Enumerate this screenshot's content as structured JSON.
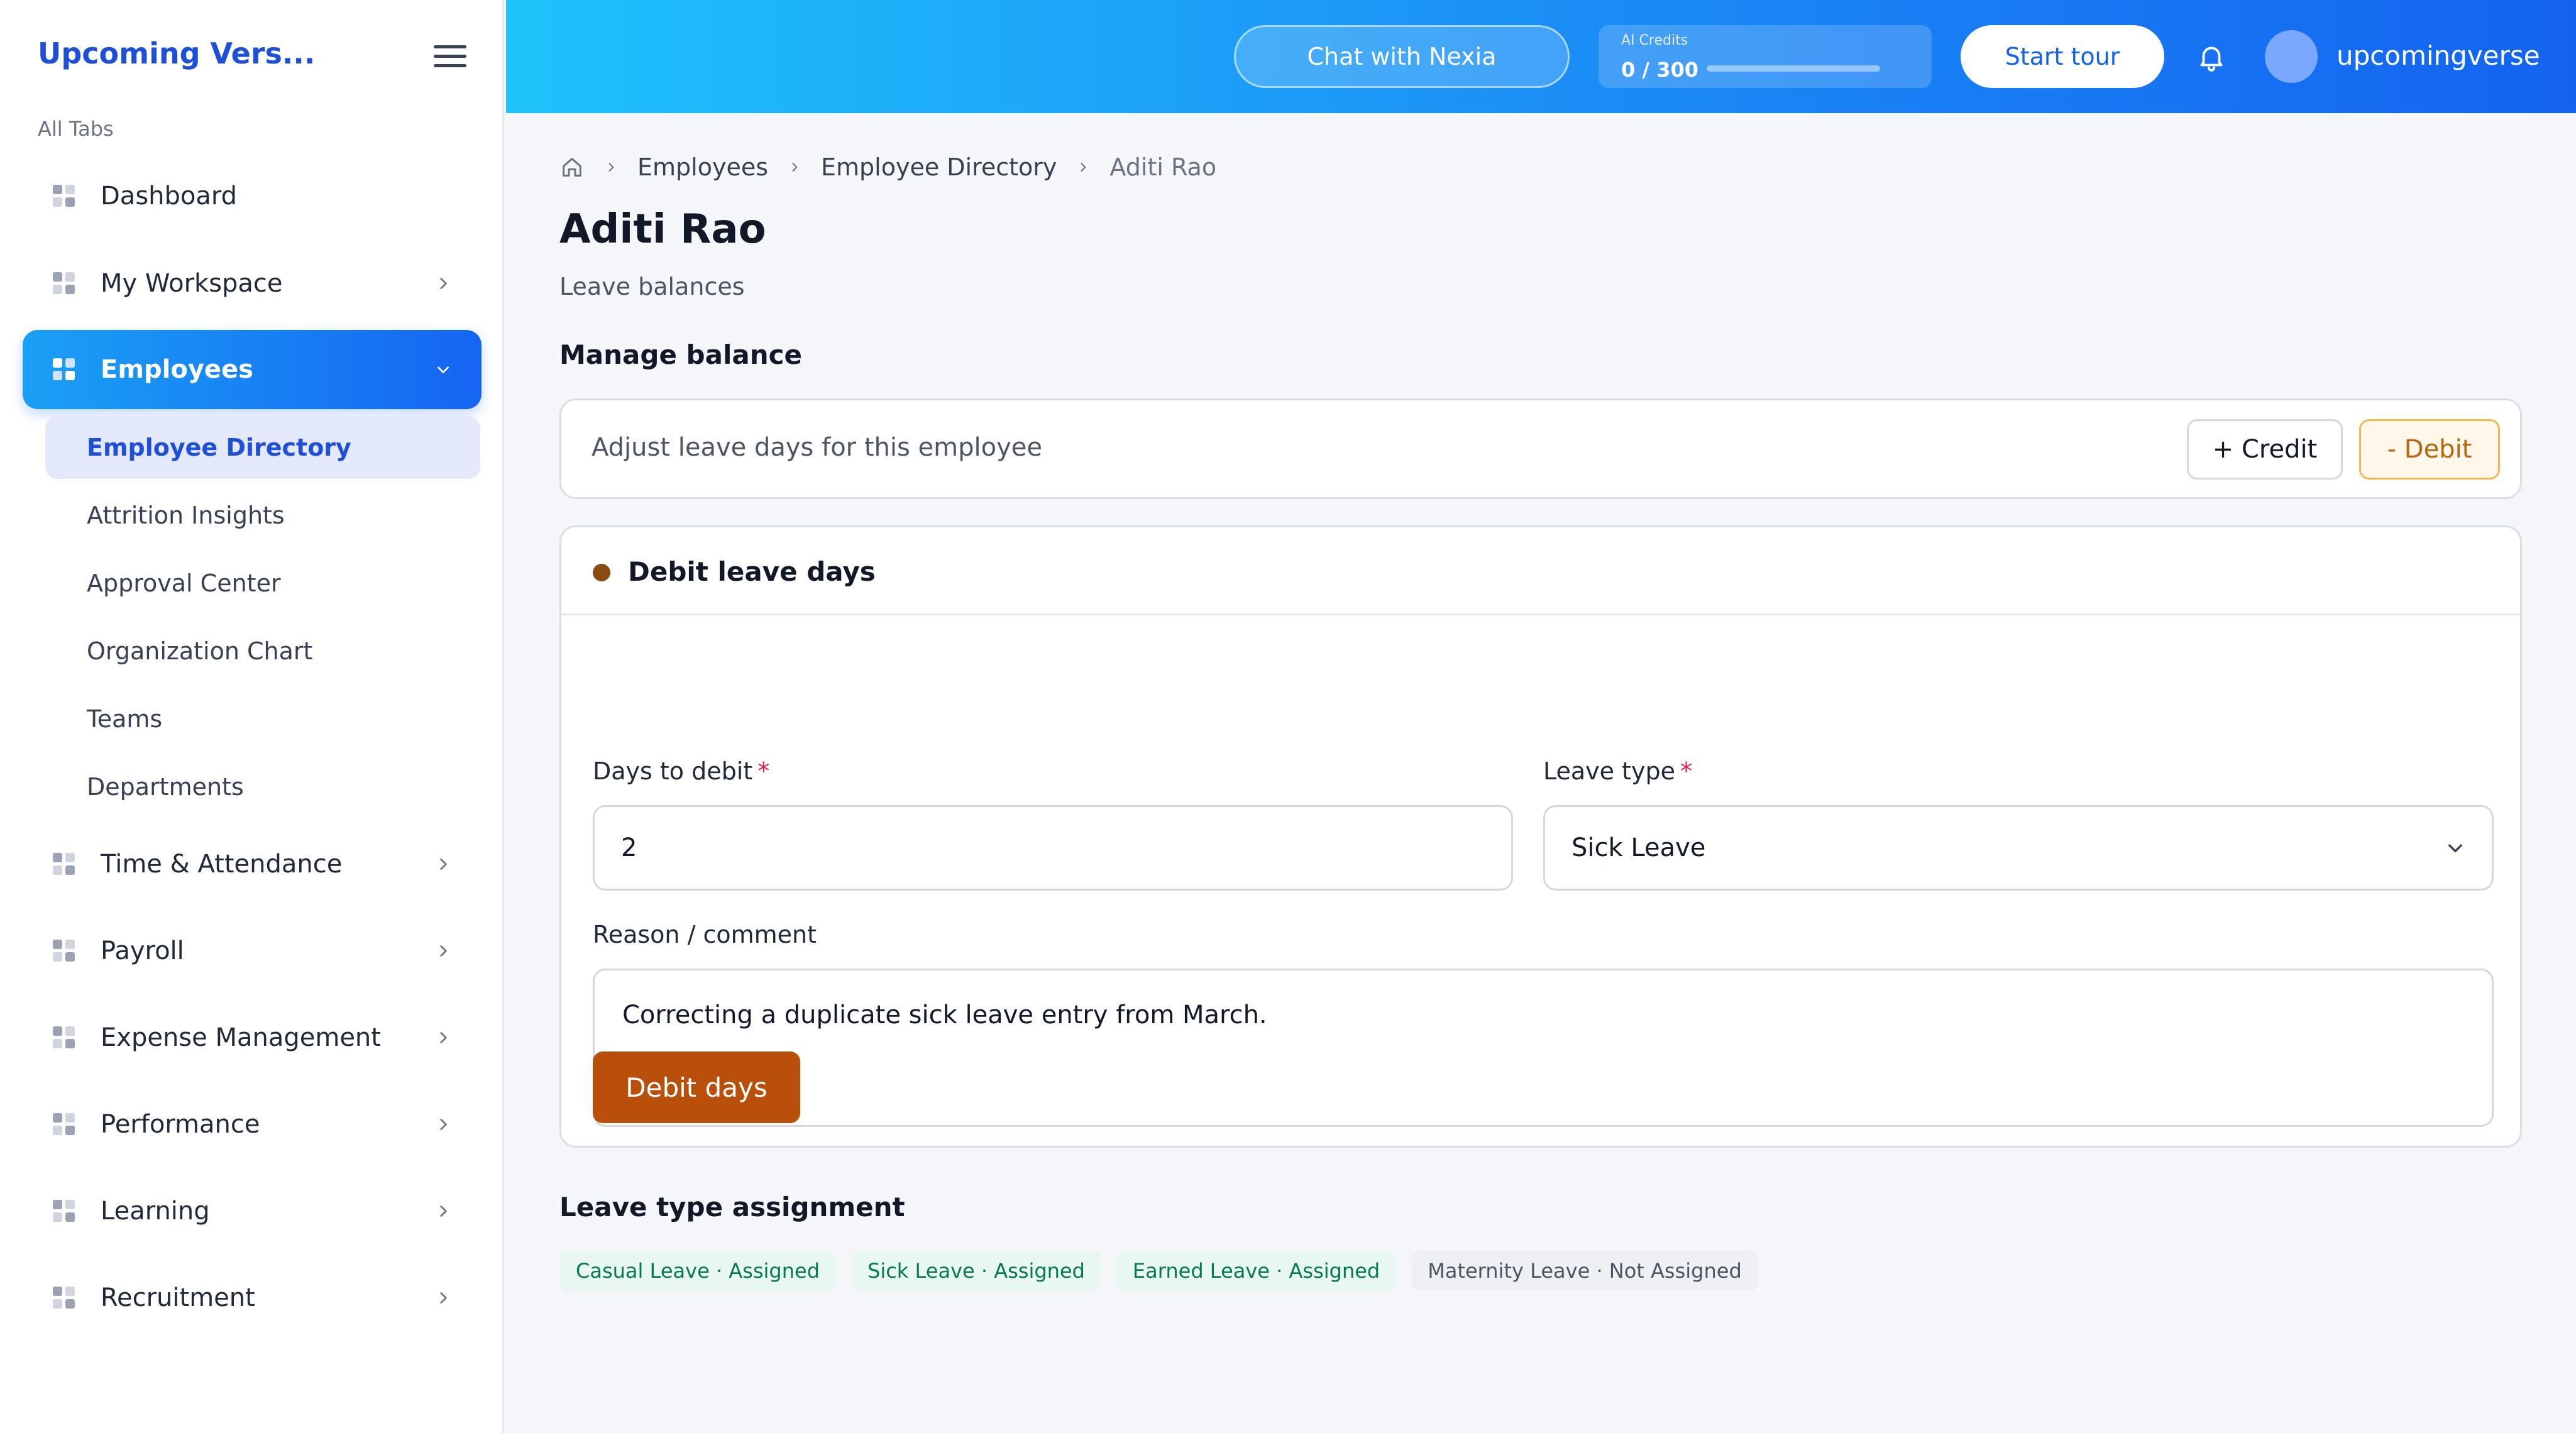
{
  "brand": "Upcoming Vers...",
  "sidebar": {
    "all_tabs": "All Tabs",
    "items": [
      {
        "label": "Dashboard"
      },
      {
        "label": "My Workspace"
      },
      {
        "label": "Employees"
      },
      {
        "label": "Time & Attendance"
      },
      {
        "label": "Payroll"
      },
      {
        "label": "Expense Management"
      },
      {
        "label": "Performance"
      },
      {
        "label": "Learning"
      },
      {
        "label": "Recruitment"
      }
    ],
    "sub_items": [
      {
        "label": "Employee Directory"
      },
      {
        "label": "Attrition Insights"
      },
      {
        "label": "Approval Center"
      },
      {
        "label": "Organization Chart"
      },
      {
        "label": "Teams"
      },
      {
        "label": "Departments"
      }
    ]
  },
  "header": {
    "chat_label": "Chat with Nexia",
    "credits_caption": "AI Credits",
    "credits_value": "0 / 300",
    "credits_fraction": 0.0,
    "tour_label": "Start tour",
    "username": "upcomingverse"
  },
  "breadcrumb": [
    "Employees",
    "Employee Directory",
    "Aditi Rao"
  ],
  "page": {
    "title": "Aditi Rao",
    "subtitle": "Leave balances",
    "manage_title": "Manage balance",
    "adjust_text": "Adjust leave days for this employee",
    "credit_label": "+ Credit",
    "debit_label": "- Debit"
  },
  "form": {
    "title": "Debit leave days",
    "days_label": "Days to debit",
    "days_value": "2",
    "leave_type_label": "Leave type",
    "leave_type_value": "Sick Leave",
    "reason_label": "Reason / comment",
    "reason_value": "Correcting a duplicate sick leave entry from March.",
    "submit_label": "Debit days",
    "required_mark": "*"
  },
  "assignment": {
    "title": "Leave type assignment",
    "chips": [
      {
        "label": "Casual Leave · Assigned",
        "assigned": true
      },
      {
        "label": "Sick Leave · Assigned",
        "assigned": true
      },
      {
        "label": "Earned Leave · Assigned",
        "assigned": true
      },
      {
        "label": "Maternity Leave · Not Assigned",
        "assigned": false
      }
    ]
  },
  "colors": {
    "accent": "#1565f2",
    "debit_accent": "#b8500c",
    "assigned": "#047857"
  },
  "icons": [
    "hamburger-icon",
    "grid-icon",
    "chevron-right-icon",
    "chevron-down-icon",
    "bell-icon",
    "home-icon"
  ]
}
